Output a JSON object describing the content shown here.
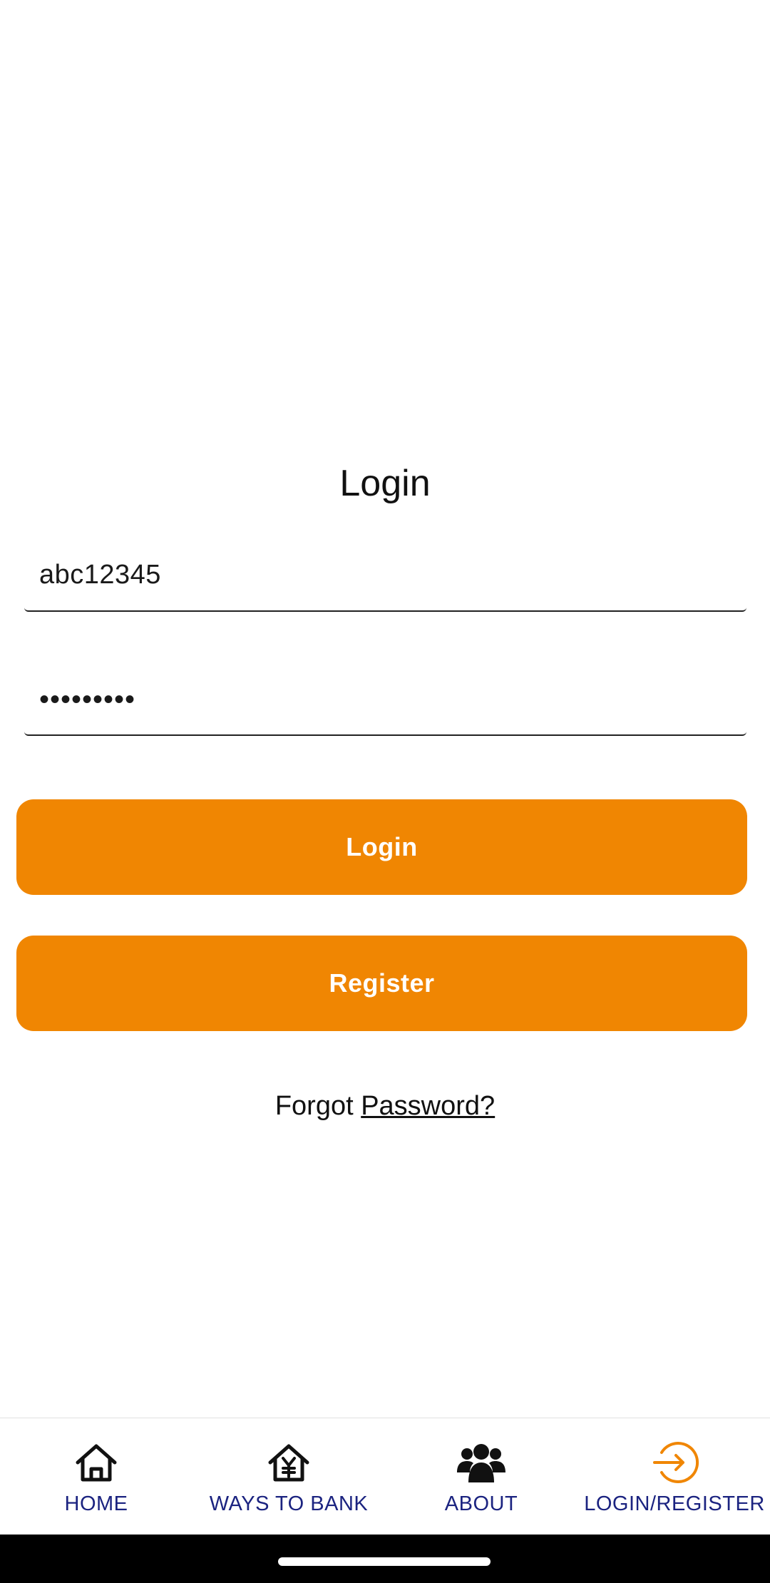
{
  "login": {
    "title": "Login",
    "username_value": "abc12345",
    "password_value": "•••••••••",
    "login_button": "Login",
    "register_button": "Register",
    "forgot_prefix": "Forgot ",
    "forgot_link": "Password?"
  },
  "nav": {
    "items": [
      {
        "label": "HOME",
        "icon": "home-icon"
      },
      {
        "label": "WAYS TO BANK",
        "icon": "bank-yen-icon"
      },
      {
        "label": "ABOUT",
        "icon": "people-group-icon"
      },
      {
        "label": "LOGIN/REGISTER",
        "icon": "login-arrow-icon",
        "active": true
      }
    ]
  },
  "colors": {
    "accent": "#f08602",
    "nav_text": "#1b2380",
    "active_icon": "#f08602"
  }
}
